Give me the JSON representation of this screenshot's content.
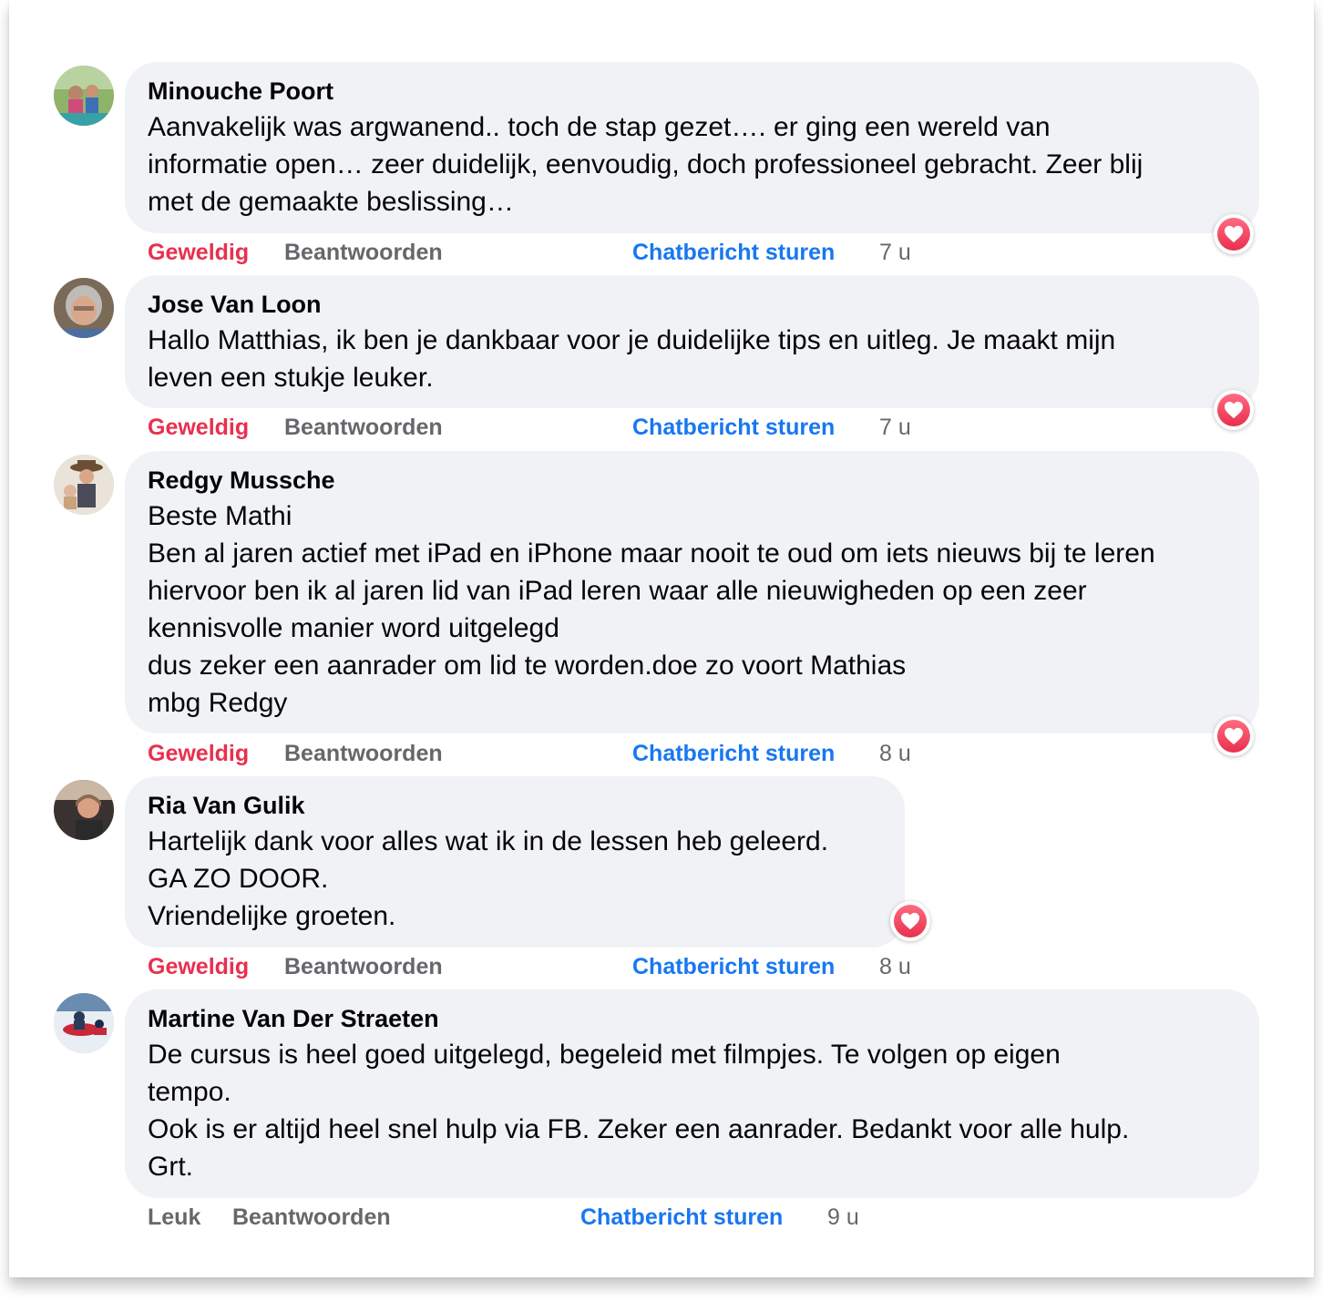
{
  "colors": {
    "bubble": "#f0f2f5",
    "love": "#e8304e",
    "link_blue": "#1877f2",
    "muted": "#65676b"
  },
  "comments": [
    {
      "author": "Minouche Poort",
      "text": "Aanvakelijk was argwanend.. toch de stap gezet…. er ging een wereld van\ninformatie open… zeer duidelijk, eenvoudig, doch professioneel gebracht. Zeer blij\nmet de gemaakte beslissing…",
      "reaction_label": "Geweldig",
      "reply_label": "Beantwoorden",
      "chat_label": "Chatbericht sturen",
      "time": "7 u",
      "reaction_icon": "heart-icon"
    },
    {
      "author": "Jose Van Loon",
      "text": "Hallo Matthias, ik ben je dankbaar voor je duidelijke tips en uitleg. Je maakt mijn\nleven een stukje leuker.",
      "reaction_label": "Geweldig",
      "reply_label": "Beantwoorden",
      "chat_label": "Chatbericht sturen",
      "time": "7 u",
      "reaction_icon": "heart-icon"
    },
    {
      "author": "Redgy Mussche",
      "text": "Beste Mathi\nBen al jaren actief met iPad en iPhone maar nooit te oud om iets nieuws bij te leren\nhiervoor ben ik al jaren lid van iPad leren waar alle nieuwigheden op een zeer\nkennisvolle manier word uitgelegd\ndus zeker een aanrader om lid te worden.doe zo voort Mathias\nmbg Redgy",
      "reaction_label": "Geweldig",
      "reply_label": "Beantwoorden",
      "chat_label": "Chatbericht sturen",
      "time": "8 u",
      "reaction_icon": "heart-icon"
    },
    {
      "author": "Ria Van Gulik",
      "text": "Hartelijk dank voor alles wat ik in de lessen heb geleerd.\nGA ZO DOOR.\nVriendelijke groeten.",
      "reaction_label": "Geweldig",
      "reply_label": "Beantwoorden",
      "chat_label": "Chatbericht sturen",
      "time": "8 u",
      "reaction_icon": "heart-icon"
    },
    {
      "author": "Martine Van Der Straeten",
      "text": "De cursus is heel goed uitgelegd, begeleid met filmpjes. Te volgen op eigen\ntempo.\nOok is er altijd heel snel hulp via FB. Zeker een aanrader. Bedankt voor alle hulp.\nGrt.",
      "reaction_label": "Leuk",
      "reply_label": "Beantwoorden",
      "chat_label": "Chatbericht sturen",
      "time": "9 u"
    }
  ]
}
